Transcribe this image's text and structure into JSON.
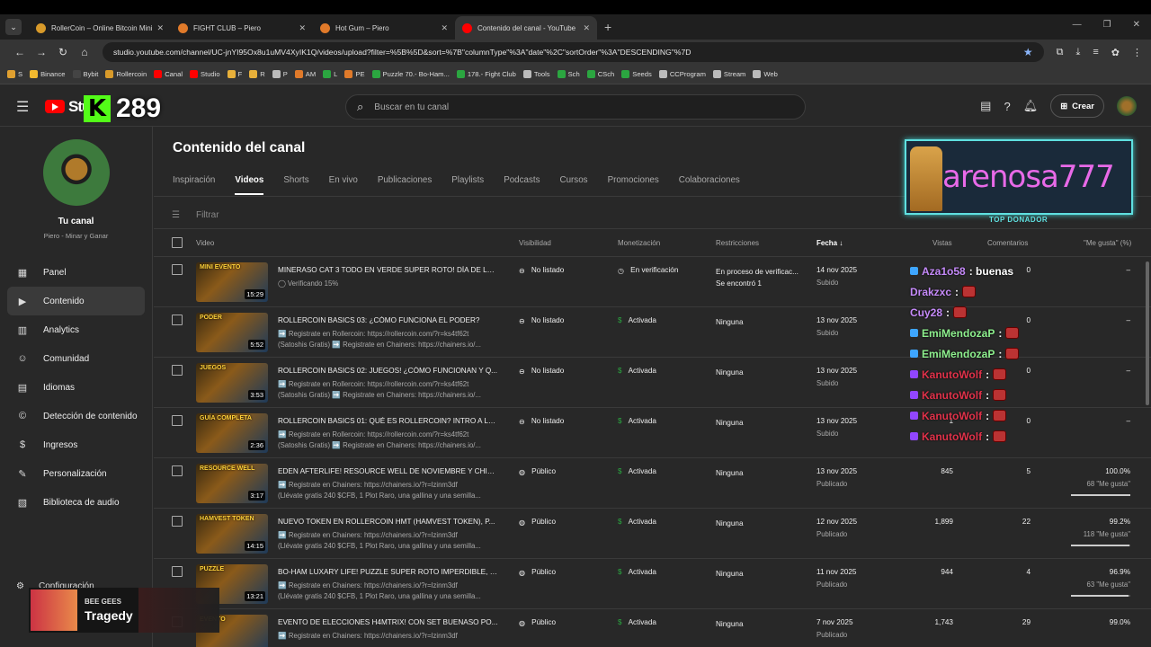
{
  "browser": {
    "tabs": [
      {
        "title": "RollerCoin – Online Bitcoin Mining",
        "color": "#d89a2a"
      },
      {
        "title": "FIGHT CLUB – Piero",
        "color": "#e07a2a"
      },
      {
        "title": "Hot Gum – Piero",
        "color": "#e07a2a"
      },
      {
        "title": "Contenido del canal - YouTube",
        "color": "#ff0000"
      }
    ],
    "url": "studio.youtube.com/channel/UC-jnYI95Ox8u1uMV4XyIK1Q/videos/upload?filter=%5B%5D&sort=%7B\"columnType\"%3A\"date\"%2C\"sortOrder\"%3A\"DESCENDING\"%7D",
    "bookmarks": [
      "S",
      "Binance",
      "Bybit",
      "Rollercoin",
      "Canal",
      "Studio",
      "F",
      "R",
      "P",
      "AM",
      "L",
      "PE",
      "Puzzle 70.- Bo-Ham...",
      "178.- Fight Club",
      "Tools",
      "Sch",
      "CSch",
      "Seeds",
      "CCProgram",
      "Stream",
      "Web"
    ]
  },
  "header": {
    "logo_text": "Stu",
    "kick_count": "289",
    "search_placeholder": "Buscar en tu canal",
    "create_label": "Crear"
  },
  "sidebar": {
    "channel_title": "Tu canal",
    "channel_name": "Piero - Minar y Ganar",
    "items": [
      {
        "label": "Panel",
        "icon": "▦"
      },
      {
        "label": "Contenido",
        "icon": "▶"
      },
      {
        "label": "Analytics",
        "icon": "▥"
      },
      {
        "label": "Comunidad",
        "icon": "☺"
      },
      {
        "label": "Idiomas",
        "icon": "▤"
      },
      {
        "label": "Detección de contenido",
        "icon": "©"
      },
      {
        "label": "Ingresos",
        "icon": "$"
      },
      {
        "label": "Personalización",
        "icon": "✎"
      },
      {
        "label": "Biblioteca de audio",
        "icon": "▧"
      }
    ],
    "settings_label": "Configuración"
  },
  "content": {
    "title": "Contenido del canal",
    "tabs": [
      "Inspiración",
      "Videos",
      "Shorts",
      "En vivo",
      "Publicaciones",
      "Playlists",
      "Podcasts",
      "Cursos",
      "Promociones",
      "Colaboraciones"
    ],
    "filter_placeholder": "Filtrar",
    "columns": {
      "video": "Video",
      "visibility": "Visibilidad",
      "monetization": "Monetización",
      "restrictions": "Restricciones",
      "date": "Fecha ↓",
      "views": "Vistas",
      "comments": "Comentarios",
      "likes": "\"Me gusta\" (%)"
    }
  },
  "rows": [
    {
      "thumb": "MINI EVENTO",
      "dur": "15:29",
      "title": "MINERASO CAT 3 TODO EN VERDE SUPER ROTO! DÍA DE LO...",
      "desc1": "◯ Verificando 15%",
      "desc2": "",
      "vis": "No listado",
      "mon": "En verificación",
      "restr": "En proceso de verificac...",
      "restr2": "Se encontró 1",
      "date": "14 nov 2025",
      "dsub": "Subido",
      "views": "",
      "comments": "0",
      "likes": "–",
      "lsub": "",
      "pct": 0
    },
    {
      "thumb": "PODER",
      "dur": "5:52",
      "title": "ROLLERCOIN BASICS 03: ¿CÓMO FUNCIONA EL PODER?",
      "desc1": "➡️ Registrate en Rollercoin: https://rollercoin.com/?r=ks4tf62t",
      "desc2": "(Satoshis Gratis) ➡️ Registrate en Chainers: https://chainers.io/...",
      "vis": "No listado",
      "mon": "Activada",
      "restr": "Ninguna",
      "restr2": "",
      "date": "13 nov 2025",
      "dsub": "Subido",
      "views": "",
      "comments": "0",
      "likes": "–",
      "lsub": "",
      "pct": 0
    },
    {
      "thumb": "JUEGOS",
      "dur": "3:53",
      "title": "ROLLERCOIN BASICS 02: JUEGOS! ¿CÓMO FUNCIONAN Y Q...",
      "desc1": "➡️ Registrate en Rollercoin: https://rollercoin.com/?r=ks4tf62t",
      "desc2": "(Satoshis Gratis) ➡️ Registrate en Chainers: https://chainers.io/...",
      "vis": "No listado",
      "mon": "Activada",
      "restr": "Ninguna",
      "restr2": "",
      "date": "13 nov 2025",
      "dsub": "Subido",
      "views": "",
      "comments": "0",
      "likes": "–",
      "lsub": "",
      "pct": 0
    },
    {
      "thumb": "GUÍA COMPLETA",
      "dur": "2:36",
      "title": "ROLLERCOIN BASICS 01: QUÉ ES ROLLERCOIN? INTRO A LA ...",
      "desc1": "➡️ Registrate en Rollercoin: https://rollercoin.com/?r=ks4tf62t",
      "desc2": "(Satoshis Gratis) ➡️ Registrate en Chainers: https://chainers.io/...",
      "vis": "No listado",
      "mon": "Activada",
      "restr": "Ninguna",
      "restr2": "",
      "date": "13 nov 2025",
      "dsub": "Subido",
      "views": "1",
      "comments": "0",
      "likes": "–",
      "lsub": "",
      "pct": 0
    },
    {
      "thumb": "RESOURCE WELL",
      "dur": "3:17",
      "title": "EDEN AFTERLIFE! RESOURCE WELL DE NOVIEMBRE Y CHIS...",
      "desc1": "➡️ Registrate en Chainers: https://chainers.io/?r=lzinm3df",
      "desc2": "(Llévate gratis 240 $CFB, 1 Plot Raro, una gallina y una semilla...",
      "vis": "Público",
      "mon": "Activada",
      "restr": "Ninguna",
      "restr2": "",
      "date": "13 nov 2025",
      "dsub": "Publicado",
      "views": "845",
      "comments": "5",
      "likes": "100.0%",
      "lsub": "68 \"Me gusta\"",
      "pct": 100
    },
    {
      "thumb": "HAMVEST TOKEN",
      "dur": "14:15",
      "title": "NUEVO TOKEN EN ROLLERCOIN HMT (HAMVEST TOKEN), P...",
      "desc1": "➡️ Registrate en Chainers: https://chainers.io/?r=lzinm3df",
      "desc2": "(Llévate gratis 240 $CFB, 1 Plot Raro, una gallina y una semilla...",
      "vis": "Público",
      "mon": "Activada",
      "restr": "Ninguna",
      "restr2": "",
      "date": "12 nov 2025",
      "dsub": "Publicado",
      "views": "1,899",
      "comments": "22",
      "likes": "99.2%",
      "lsub": "118 \"Me gusta\"",
      "pct": 99.2
    },
    {
      "thumb": "PUZZLE",
      "dur": "13:21",
      "title": "BO-HAM LUXARY LIFE! PUZZLE SUPER ROTO IMPERDIBLE, D...",
      "desc1": "➡️ Registrate en Chainers: https://chainers.io/?r=lzinm3df",
      "desc2": "(Llévate gratis 240 $CFB, 1 Plot Raro, una gallina y una semilla...",
      "vis": "Público",
      "mon": "Activada",
      "restr": "Ninguna",
      "restr2": "",
      "date": "11 nov 2025",
      "dsub": "Publicado",
      "views": "944",
      "comments": "4",
      "likes": "96.9%",
      "lsub": "63 \"Me gusta\"",
      "pct": 96.9
    },
    {
      "thumb": "EVENTO",
      "dur": "",
      "title": "EVENTO DE ELECCIONES H4MTRIX! CON SET BUENASO PO...",
      "desc1": "➡️ Registrate en Chainers: https://chainers.io/?r=lzinm3df",
      "desc2": "",
      "vis": "Público",
      "mon": "Activada",
      "restr": "Ninguna",
      "restr2": "",
      "date": "7 nov 2025",
      "dsub": "Publicado",
      "views": "1,743",
      "comments": "29",
      "likes": "99.0%",
      "lsub": "",
      "pct": 99
    }
  ],
  "overlay": {
    "donor_name": "arenosa777",
    "donor_label": "TOP DONADOR",
    "chat": [
      {
        "user": "Aza1o58",
        "msg": ": buenas",
        "color": "#c58af9",
        "emote": false
      },
      {
        "user": "Drakzxc",
        "msg": ":",
        "color": "#c58af9",
        "emote": true
      },
      {
        "user": "Cuy28",
        "msg": ":",
        "color": "#c58af9",
        "emote": true
      },
      {
        "user": "EmiMendozaP",
        "msg": ":",
        "color": "#8ef08e",
        "emote": true
      },
      {
        "user": "EmiMendozaP",
        "msg": ":",
        "color": "#8ef08e",
        "emote": true
      },
      {
        "user": "KanutoWolf",
        "msg": ":",
        "color": "#e0324a",
        "emote": true
      },
      {
        "user": "KanutoWolf",
        "msg": ":",
        "color": "#e0324a",
        "emote": true
      },
      {
        "user": "KanutoWolf",
        "msg": ":",
        "color": "#e0324a",
        "emote": true
      },
      {
        "user": "KanutoWolf",
        "msg": ":",
        "color": "#e0324a",
        "emote": true
      }
    ],
    "music_artist": "BEE GEES",
    "music_song": "Tragedy"
  }
}
